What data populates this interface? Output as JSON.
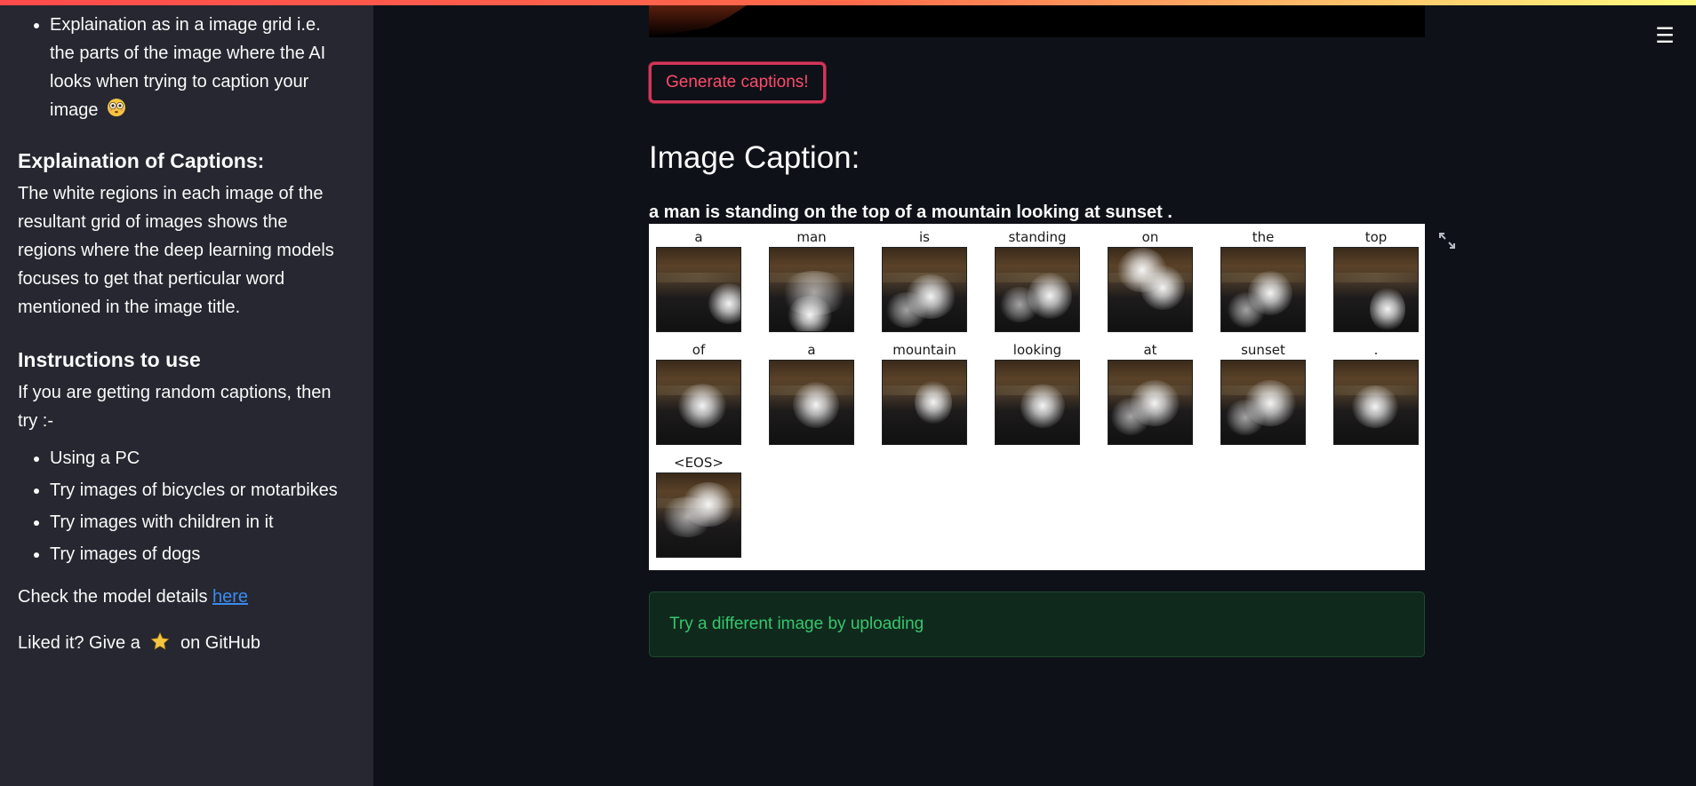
{
  "sidebar": {
    "top_bullet_lines": [
      "Explaination as in a image grid i.e.",
      "the parts of the image where the AI",
      "looks when trying to caption your",
      "image"
    ],
    "explanation_heading": "Explaination of Captions:",
    "explanation_text_lines": [
      "The white regions in each image of the",
      "resultant grid of images shows the",
      "regions where the deep learning models",
      "focuses to get that perticular word",
      "mentioned in the image title."
    ],
    "instructions_heading": "Instructions to use",
    "instructions_intro_lines": [
      "If you are getting random captions, then",
      "try :-"
    ],
    "instructions": [
      "Using a PC",
      "Try images of bicycles or motarbikes",
      "Try images with children in it",
      "Try images of dogs"
    ],
    "model_details_prefix": "Check the model details",
    "model_details_link": "here",
    "liked_prefix": "Liked it? Give a",
    "liked_suffix": "on GitHub"
  },
  "main": {
    "generate_button": "Generate captions!",
    "caption_heading": "Image Caption:",
    "caption_sentence": "a man is standing on the top of a mountain looking at sunset .",
    "attention_words": [
      "a",
      "man",
      "is",
      "standing",
      "on",
      "the",
      "top",
      "of",
      "a",
      "mountain",
      "looking",
      "at",
      "sunset",
      ".",
      "<EOS>"
    ],
    "info_message": "Try a different image by uploading"
  },
  "icons": {
    "menu": "hamburger-menu-icon",
    "expand": "fullscreen-expand-icon",
    "eyes_emoji": "flushed-face-icon",
    "star": "star-icon"
  },
  "colors": {
    "background": "#0e1117",
    "sidebar": "#262730",
    "button_border": "#d3365b",
    "button_text": "#ff4b6b",
    "info_bg": "#10291d",
    "info_text": "#34c76b",
    "link": "#3b8bf0"
  }
}
